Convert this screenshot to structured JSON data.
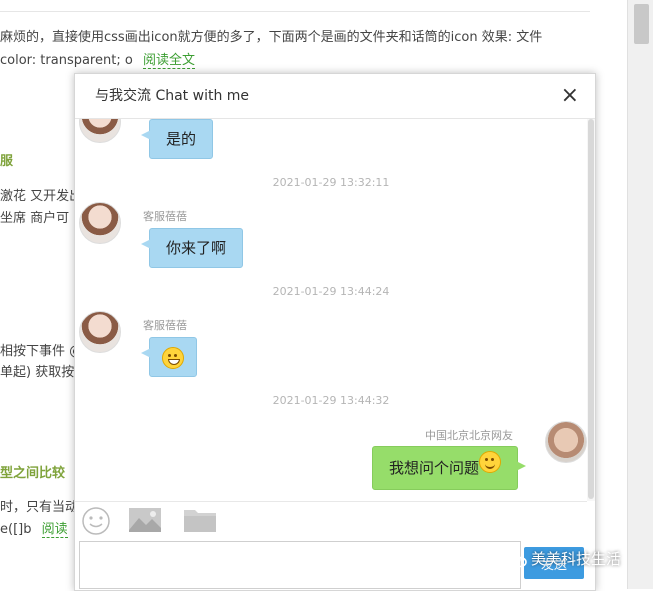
{
  "background": {
    "lines": [
      "麻烦的，直接使用css画出icon就方便的多了，下面两个是画的文件夹和话筒的icon 效果: 文件",
      "color: transparent; o",
      "服",
      "激花 又开发出",
      "坐席 商户可",
      "相按下事件 @",
      "单起) 获取按",
      "型之间比较",
      "时，只有当动",
      "e([]b"
    ],
    "read_more": "阅读全文",
    "read_more_short": "阅读"
  },
  "chat": {
    "title": "与我交流 Chat with me",
    "close_label": "×",
    "messages": [
      {
        "type": "agent",
        "text": "是的"
      },
      {
        "type": "time",
        "text": "2021-01-29 13:32:11"
      },
      {
        "type": "agent",
        "sender": "客服蓓蓓",
        "text": "你来了啊"
      },
      {
        "type": "time",
        "text": "2021-01-29 13:44:24"
      },
      {
        "type": "agent",
        "sender": "客服蓓蓓",
        "emoji": "grin-emoji"
      },
      {
        "type": "time",
        "text": "2021-01-29 13:44:32"
      },
      {
        "type": "user",
        "sender": "中国北京北京网友",
        "text": "我想问个问题",
        "emoji": "smile-emoji"
      }
    ],
    "toolbar": {
      "icons": [
        "smile-icon",
        "image-icon",
        "folder-icon"
      ]
    },
    "input_value": "",
    "send_label": "发送"
  },
  "watermark": "美美科技生活",
  "colors": {
    "agent_bubble": "#a9d8f2",
    "user_bubble": "#96dd6a",
    "link_green": "#3c9e32",
    "send_blue": "#3d9be0"
  }
}
